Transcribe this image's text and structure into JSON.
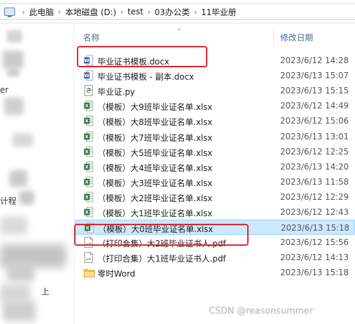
{
  "breadcrumb": {
    "items": [
      "此电脑",
      "本地磁盘 (D:)",
      "test",
      "03办公类",
      "11毕业册"
    ],
    "separator": "›"
  },
  "nav": {
    "fragments": [
      "er",
      "计程",
      "上"
    ]
  },
  "columns": {
    "name": "名称",
    "date": "修改日期"
  },
  "files": [
    {
      "icon": "word-doc-icon",
      "name": "毕业证书模板.docx",
      "date": "2023/6/12 14:28"
    },
    {
      "icon": "word-doc-icon",
      "name": "毕业证书模板 - 副本.docx",
      "date": "2023/6/13 15:07"
    },
    {
      "icon": "python-file-icon",
      "name": "毕业证.py",
      "date": "2023/6/13 15:15"
    },
    {
      "icon": "excel-file-icon",
      "name": "（模板）大9班毕业证名单.xlsx",
      "date": "2023/6/12 14:49"
    },
    {
      "icon": "excel-file-icon",
      "name": "（模板）大8班毕业证名单.xlsx",
      "date": "2023/6/12 15:06"
    },
    {
      "icon": "excel-file-icon",
      "name": "（模板）大7班毕业证名单.xlsx",
      "date": "2023/6/13 13:01"
    },
    {
      "icon": "excel-file-icon",
      "name": "（模板）大5班毕业证名单.xlsx",
      "date": "2023/6/12 12:25"
    },
    {
      "icon": "excel-file-icon",
      "name": "（模板）大4班毕业证名单.xlsx",
      "date": "2023/6/13 14:20"
    },
    {
      "icon": "excel-file-icon",
      "name": "（模板）大3班毕业证名单.xlsx",
      "date": "2023/6/13 11:58"
    },
    {
      "icon": "excel-file-icon",
      "name": "（模板）大2班毕业证名单.xlsx",
      "date": "2023/6/12 12:29"
    },
    {
      "icon": "excel-file-icon",
      "name": "（模板）大1班毕业证名单.xlsx",
      "date": "2023/6/12 12:43"
    },
    {
      "icon": "excel-file-icon",
      "name": "（模板）大0班毕业证名单.xlsx",
      "date": "2023/6/13 15:18",
      "selected": true
    },
    {
      "icon": "pdf-file-icon",
      "name": "（打印合集）大2班毕业证书人.pdf",
      "date": "2023/6/12 15:56"
    },
    {
      "icon": "pdf-file-icon",
      "name": "（打印合集）大1班毕业证书人.pdf",
      "date": "2023/6/12 14:13"
    },
    {
      "icon": "folder-icon",
      "name": "零时Word",
      "date": "2023/6/13 15:18"
    }
  ],
  "watermark": "CSDN @reasonsummer",
  "colors": {
    "highlight": "#e0232b",
    "selection": "#cce8ff",
    "header_text": "#4a6a95",
    "excel_green": "#1e7145",
    "word_blue": "#2b579a"
  }
}
